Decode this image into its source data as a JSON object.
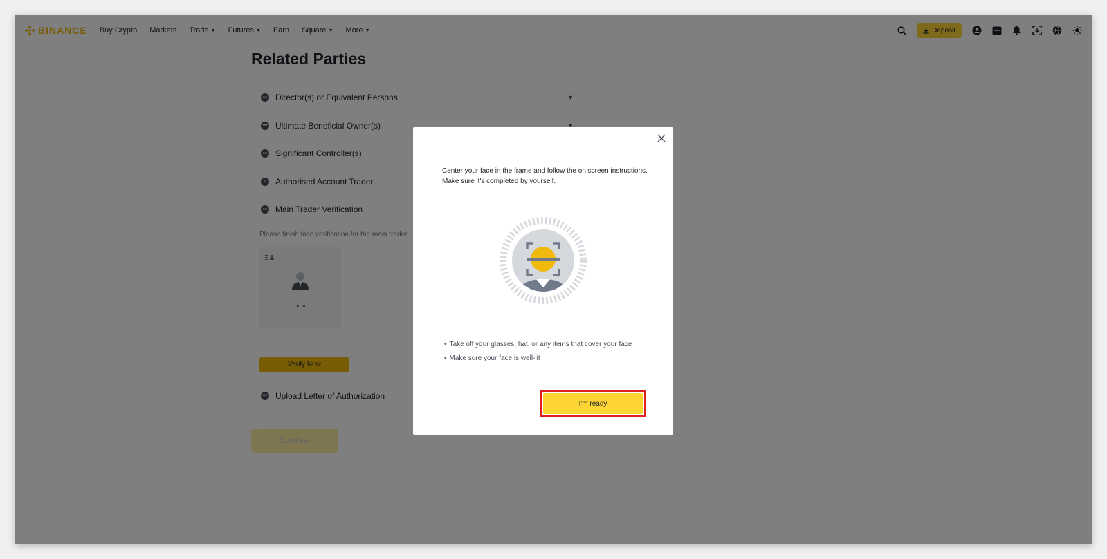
{
  "header": {
    "brand": "BINANCE",
    "nav": [
      {
        "label": "Buy Crypto",
        "has_menu": false
      },
      {
        "label": "Markets",
        "has_menu": false
      },
      {
        "label": "Trade",
        "has_menu": true
      },
      {
        "label": "Futures",
        "has_menu": true
      },
      {
        "label": "Earn",
        "has_menu": false
      },
      {
        "label": "Square",
        "has_menu": true
      },
      {
        "label": "More",
        "has_menu": true
      }
    ],
    "deposit_label": "Deposit",
    "icons": [
      "search-icon",
      "user-icon",
      "wallet-icon",
      "bell-icon",
      "download-app-icon",
      "globe-icon",
      "theme-icon"
    ]
  },
  "page": {
    "title": "Related Parties",
    "parties": [
      {
        "label": "Director(s) or Equivalent Persons",
        "status": "pending",
        "expandable": true
      },
      {
        "label": "Ultimate Beneficial Owner(s)",
        "status": "pending",
        "expandable": true
      },
      {
        "label": "Significant Controller(s)",
        "status": "pending",
        "expandable": false
      },
      {
        "label": "Authorised Account Trader",
        "status": "done",
        "expandable": false
      },
      {
        "label": "Main Trader Verification",
        "status": "pending",
        "expandable": false
      }
    ],
    "verify_note": "Please finish face verification for the main trader",
    "verify_button": "Verify Now",
    "upload_label": "Upload Letter of Authorization",
    "continue_button": "Continue"
  },
  "modal": {
    "instructions": "Center your face in the frame and follow the on screen instructions. Make sure it's completed by yourself.",
    "tips": [
      "Take off your glasses, hat, or any items that cover your face",
      "Make sure your face is well-lit"
    ],
    "ready_button": "I'm ready"
  },
  "colors": {
    "brand": "#f0b90b",
    "button": "#fcd535",
    "highlight": "#e02020"
  }
}
